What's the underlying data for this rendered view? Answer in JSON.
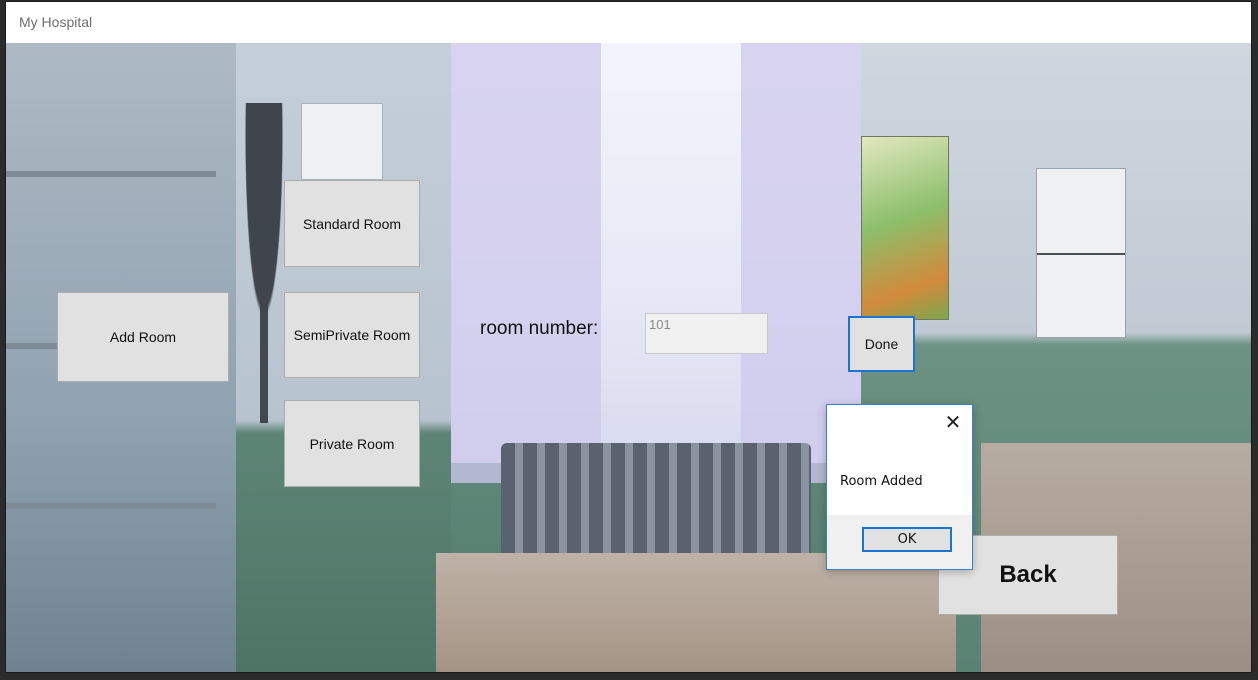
{
  "window": {
    "title": "My Hospital"
  },
  "buttons": {
    "add_room": "Add Room",
    "standard_room": "Standard Room",
    "semiprivate_room": "SemiPrivate Room",
    "private_room": "Private Room",
    "done": "Done",
    "back": "Back"
  },
  "room_number": {
    "label": "room number:",
    "value": "101"
  },
  "message_box": {
    "text": "Room Added",
    "ok_label": "OK",
    "close_glyph": "✕"
  },
  "colors": {
    "focus_accent": "#1a74d2",
    "button_face": "#e1e1e1"
  },
  "icons": {
    "close": "close-icon"
  }
}
